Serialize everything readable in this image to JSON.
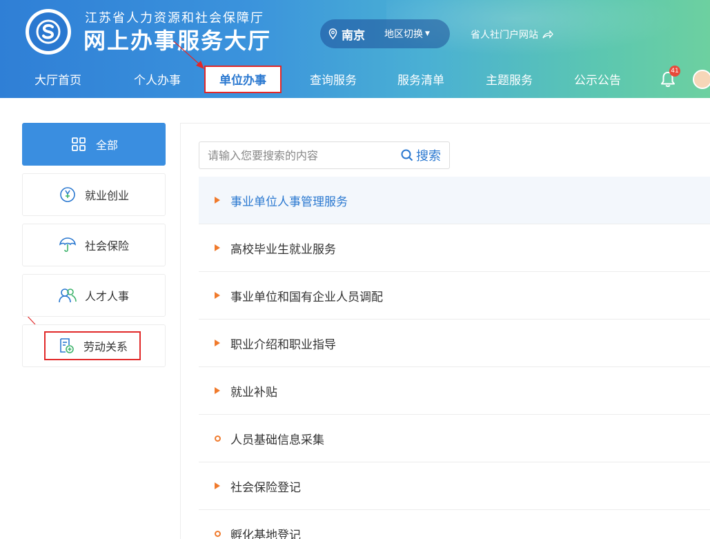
{
  "header": {
    "subtitle": "江苏省人力资源和社会保障厅",
    "title": "网上办事服务大厅",
    "region": {
      "city": "南京",
      "switch_label": "地区切换"
    },
    "portal_link": "省人社门户网站",
    "notification_count": "41",
    "brand_color": "#2a78d0"
  },
  "nav": {
    "items": [
      {
        "label": "大厅首页"
      },
      {
        "label": "个人办事"
      },
      {
        "label": "单位办事"
      },
      {
        "label": "查询服务"
      },
      {
        "label": "服务清单"
      },
      {
        "label": "主题服务"
      },
      {
        "label": "公示公告"
      }
    ],
    "active": "单位办事"
  },
  "sidebar": {
    "items": [
      {
        "label": "全部",
        "icon": "grid-icon"
      },
      {
        "label": "就业创业",
        "icon": "employment-icon"
      },
      {
        "label": "社会保险",
        "icon": "umbrella-icon"
      },
      {
        "label": "人才人事",
        "icon": "people-icon"
      },
      {
        "label": "劳动关系",
        "icon": "document-plus-icon"
      }
    ]
  },
  "search": {
    "placeholder": "请输入您要搜索的内容",
    "button_label": "搜索"
  },
  "list": {
    "items": [
      {
        "label": "事业单位人事管理服务",
        "marker": "triangle"
      },
      {
        "label": "高校毕业生就业服务",
        "marker": "triangle"
      },
      {
        "label": "事业单位和国有企业人员调配",
        "marker": "triangle"
      },
      {
        "label": "职业介绍和职业指导",
        "marker": "triangle"
      },
      {
        "label": "就业补贴",
        "marker": "triangle"
      },
      {
        "label": "人员基础信息采集",
        "marker": "ring"
      },
      {
        "label": "社会保险登记",
        "marker": "triangle"
      },
      {
        "label": "孵化基地登记",
        "marker": "ring"
      }
    ]
  }
}
